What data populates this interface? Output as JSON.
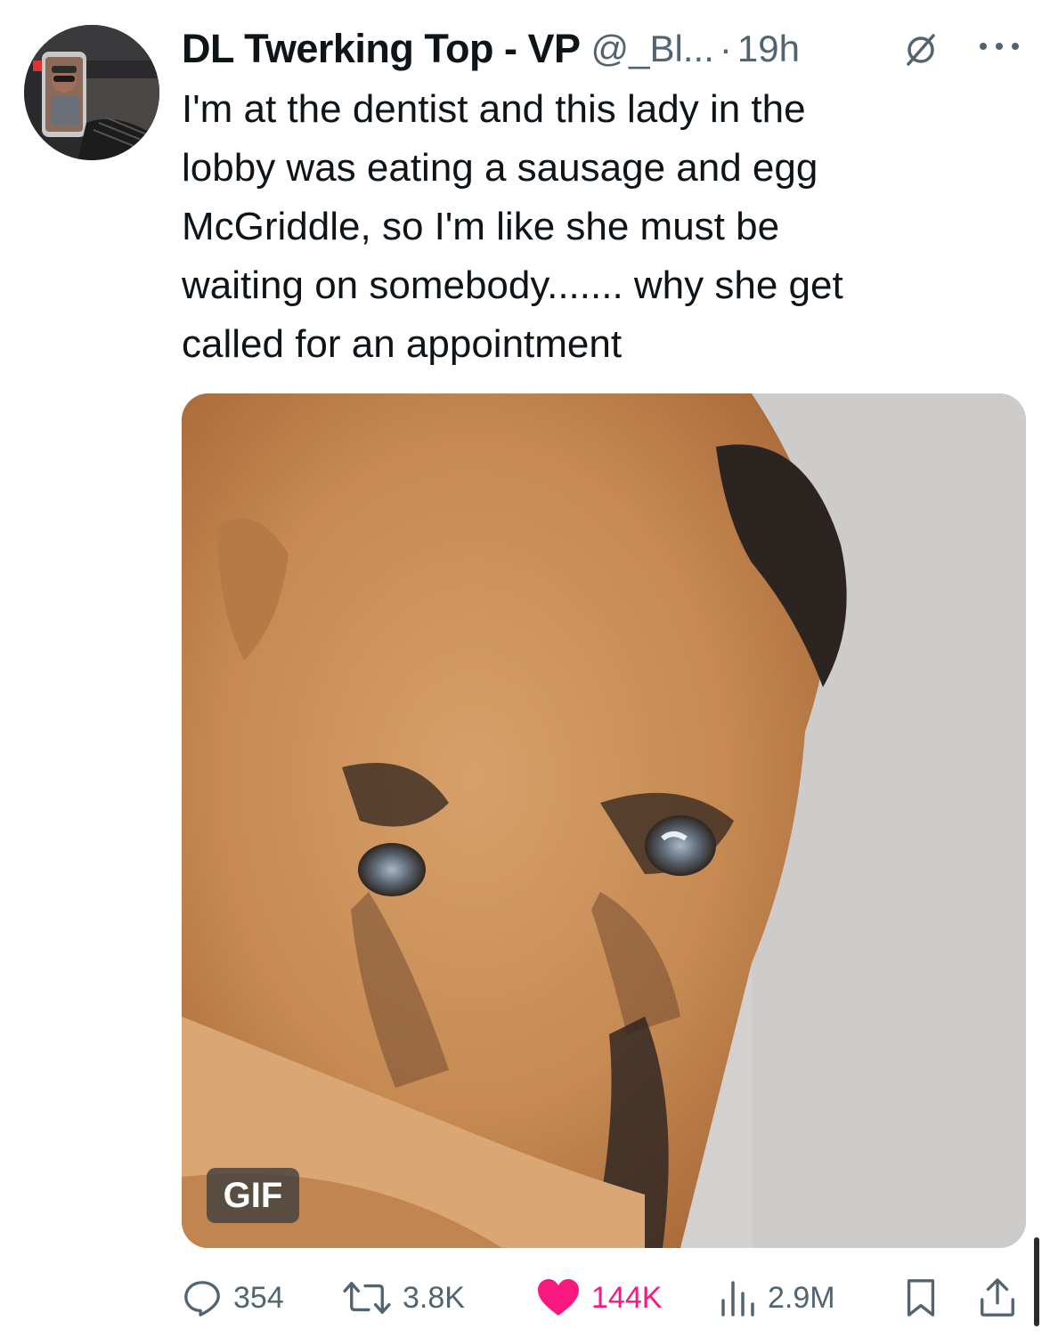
{
  "tweet": {
    "display_name": "DL Twerking Top - VP",
    "handle": "@_Bl...",
    "separator": "·",
    "time": "19h",
    "text": "I'm at the dentist and this lady in the\nlobby was eating a sausage and egg\nMcGriddle, so I'm like she must be\nwaiting on somebody....... why she get\ncalled for an appointment",
    "media": {
      "badge": "GIF"
    },
    "stats": {
      "replies": "354",
      "retweets": "3.8K",
      "likes": "144K",
      "views": "2.9M"
    },
    "liked": true
  },
  "icons": {
    "avatar": "avatar",
    "grok": "grok-icon",
    "more": "more-icon",
    "reply": "reply-icon",
    "retweet": "retweet-icon",
    "like": "heart-icon",
    "views": "views-icon",
    "bookmark": "bookmark-icon",
    "share": "share-icon"
  },
  "colors": {
    "text_primary": "#0f1419",
    "text_secondary": "#536471",
    "like_active": "#f91880"
  }
}
